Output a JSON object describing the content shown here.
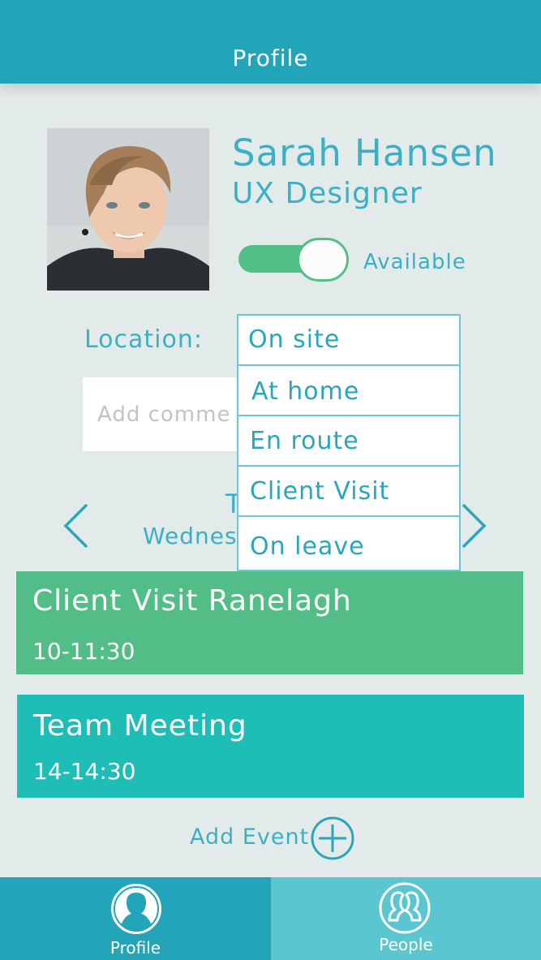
{
  "header": {
    "title": "Profile"
  },
  "profile": {
    "name": "Sarah Hansen",
    "role": "UX Designer",
    "availability_on": true,
    "availability_label": "Available"
  },
  "location": {
    "label": "Location:",
    "options": [
      "On site",
      "At home",
      "En route",
      "Client Visit",
      "On leave"
    ]
  },
  "comment": {
    "placeholder": "Add comme",
    "value": ""
  },
  "day": {
    "title": "T",
    "subtitle": "Wednes"
  },
  "events": [
    {
      "title": "Client Visit Ranelagh",
      "time": "10-11:30",
      "color": "#52bd86"
    },
    {
      "title": "Team Meeting",
      "time": "14-14:30",
      "color": "#1ebdb5"
    }
  ],
  "add_event": {
    "label": "Add Event"
  },
  "tabs": [
    {
      "label": "Profile",
      "active": true,
      "color": "#22a5b8"
    },
    {
      "label": "People",
      "active": false,
      "color": "#5bc6d0"
    }
  ],
  "colors": {
    "accent": "#3bb0c5",
    "header": "#22a5b8",
    "background": "#e3eaea",
    "toggle": "#52bf87"
  }
}
